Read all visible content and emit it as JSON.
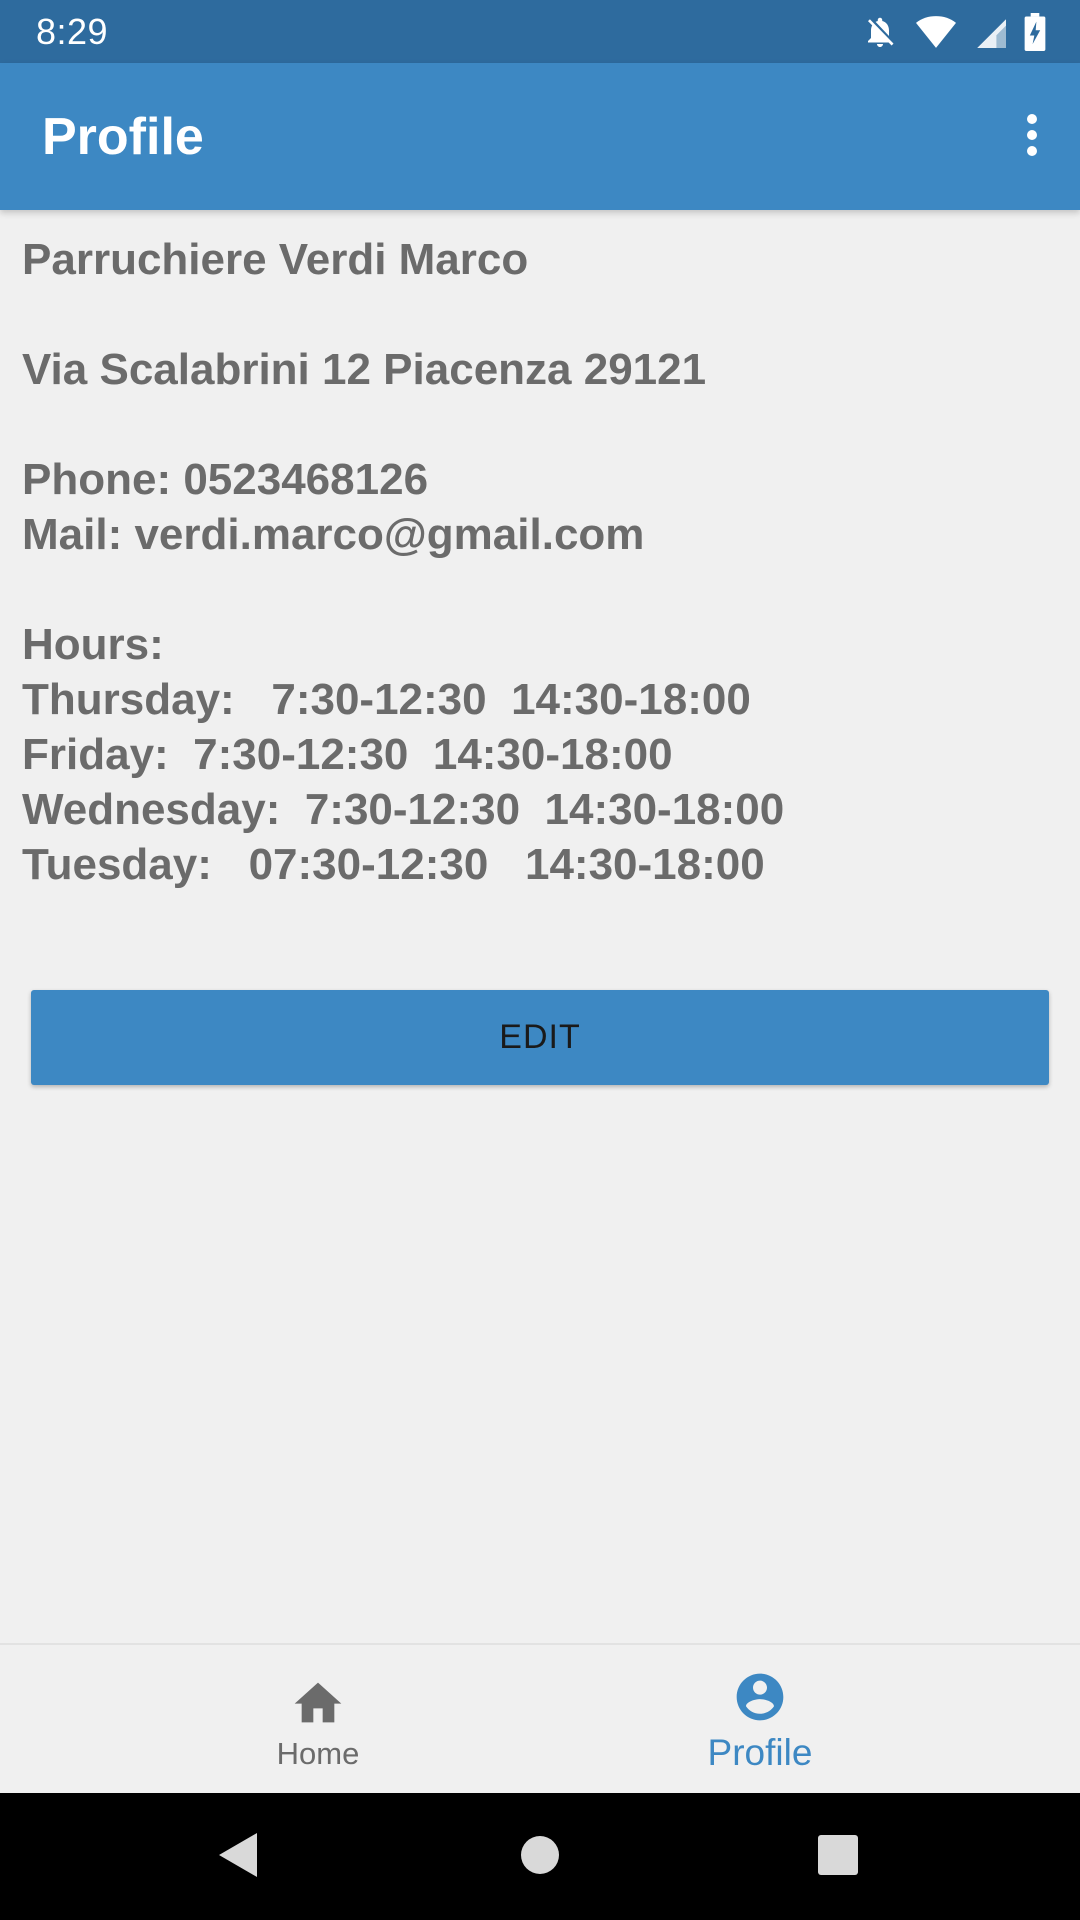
{
  "status_bar": {
    "time": "8:29",
    "icons": [
      "notifications-off-icon",
      "wifi-icon",
      "cell-signal-icon",
      "battery-charging-icon"
    ]
  },
  "app_bar": {
    "title": "Profile",
    "overflow_icon": "more-vert-icon"
  },
  "profile": {
    "name": "Parruchiere Verdi Marco",
    "address": "Via Scalabrini 12 Piacenza 29121",
    "phone": "Phone: 0523468126",
    "mail": "Mail: verdi.marco@gmail.com",
    "hours_label": "Hours:",
    "hours": [
      "Thursday:   7:30-12:30  14:30-18:00",
      "Friday:  7:30-12:30  14:30-18:00",
      "Wednesday:  7:30-12:30  14:30-18:00",
      "Tuesday:   07:30-12:30   14:30-18:00"
    ]
  },
  "edit_button": {
    "label": "EDIT"
  },
  "bottom_nav": {
    "items": [
      {
        "label": "Home",
        "icon": "home-icon",
        "active": false
      },
      {
        "label": "Profile",
        "icon": "account-circle-icon",
        "active": true
      }
    ]
  },
  "system_nav": {
    "icons": [
      "back-icon",
      "home-circle-icon",
      "recents-icon"
    ]
  },
  "colors": {
    "status_bar": "#2e6b9e",
    "primary": "#3d88c3",
    "background": "#f0f0f0",
    "text": "#6b6b6b"
  }
}
